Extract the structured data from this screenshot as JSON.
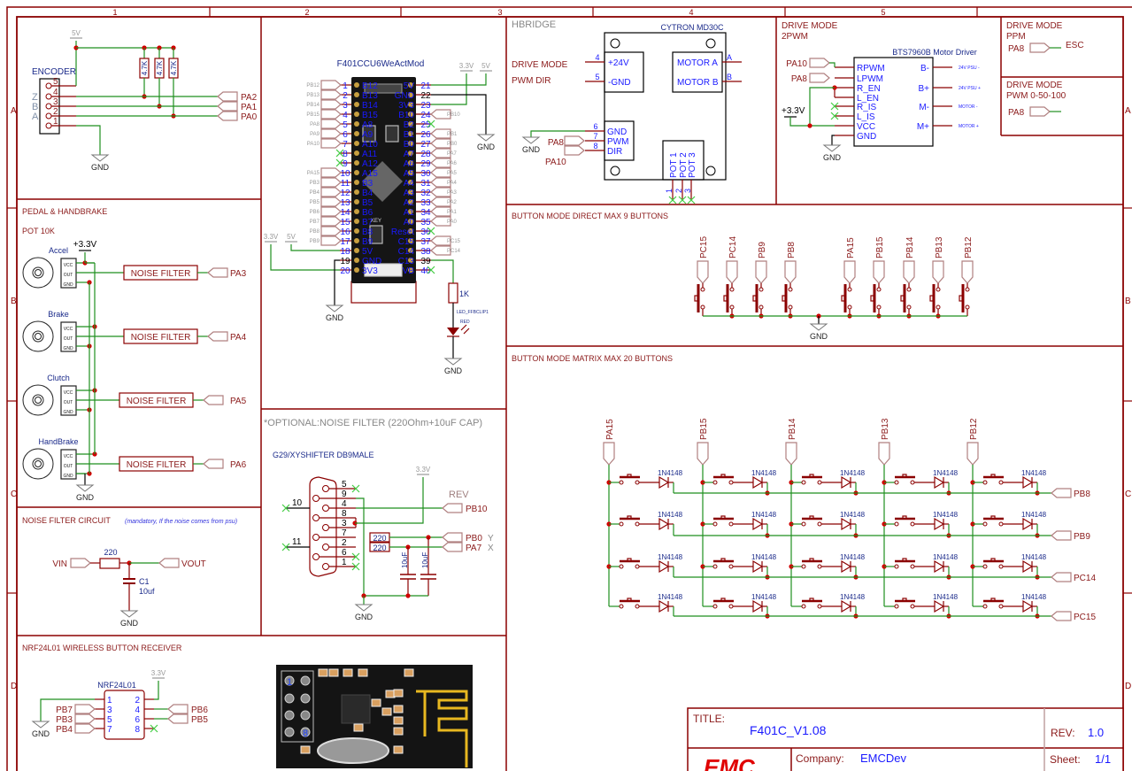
{
  "frame": {
    "columns": [
      "1",
      "2",
      "3",
      "4",
      "5"
    ],
    "rows": [
      "A",
      "B",
      "C",
      "D"
    ]
  },
  "colors": {
    "frame": "#8b0000",
    "wire": "#1f8f1f",
    "part": "#8b0000",
    "label": "#8b1a1a",
    "pin_number": "#1a1aff",
    "part_text": "#1a2a8a",
    "junction": "#d00000",
    "no_connect": "#44cc44",
    "flag": "#b08080",
    "supply": "#999999"
  },
  "encoder": {
    "title": "ENCODER",
    "supply": "5V",
    "gnd": "GND",
    "pins": [
      "5",
      "4",
      "3",
      "2",
      "1"
    ],
    "channels": [
      "Z",
      "B",
      "A"
    ],
    "resistors": [
      "4.7K",
      "4.7K",
      "4.7K"
    ],
    "nets": [
      "PA2",
      "PA1",
      "PA0"
    ]
  },
  "mcu": {
    "title": "F401CCU6WeActMod",
    "left_pins": [
      {
        "num": "1",
        "name": "B12",
        "net": "PB12"
      },
      {
        "num": "2",
        "name": "B13",
        "net": "PB13"
      },
      {
        "num": "3",
        "name": "B14",
        "net": "PB14"
      },
      {
        "num": "4",
        "name": "B15",
        "net": "PB15"
      },
      {
        "num": "5",
        "name": "A8",
        "net": "PA8"
      },
      {
        "num": "6",
        "name": "A9",
        "net": "PA9"
      },
      {
        "num": "7",
        "name": "A10",
        "net": "PA10"
      },
      {
        "num": "8",
        "name": "A11"
      },
      {
        "num": "9",
        "name": "A12"
      },
      {
        "num": "10",
        "name": "A15",
        "net": "PA15"
      },
      {
        "num": "11",
        "name": "B3",
        "net": "PB3"
      },
      {
        "num": "12",
        "name": "B4",
        "net": "PB4"
      },
      {
        "num": "13",
        "name": "B5",
        "net": "PB5"
      },
      {
        "num": "14",
        "name": "B6",
        "net": "PB6"
      },
      {
        "num": "15",
        "name": "B7",
        "net": "PB7"
      },
      {
        "num": "16",
        "name": "B8",
        "net": "PB8"
      },
      {
        "num": "17",
        "name": "B9",
        "net": "PB9"
      },
      {
        "num": "18",
        "name": "5V"
      },
      {
        "num": "19",
        "name": "GND"
      },
      {
        "num": "20",
        "name": "3V3"
      }
    ],
    "right_pins": [
      {
        "num": "21",
        "name": "5V"
      },
      {
        "num": "22",
        "name": "GND"
      },
      {
        "num": "23",
        "name": "3V3"
      },
      {
        "num": "24",
        "name": "B10",
        "net": "PB10"
      },
      {
        "num": "25",
        "name": "B2"
      },
      {
        "num": "26",
        "name": "B1",
        "net": "PB1"
      },
      {
        "num": "27",
        "name": "B0",
        "net": "PB0"
      },
      {
        "num": "28",
        "name": "A7",
        "net": "PA7"
      },
      {
        "num": "29",
        "name": "A6",
        "net": "PA6"
      },
      {
        "num": "30",
        "name": "A5",
        "net": "PA5"
      },
      {
        "num": "31",
        "name": "A4",
        "net": "PA4"
      },
      {
        "num": "32",
        "name": "A3",
        "net": "PA3"
      },
      {
        "num": "33",
        "name": "A2",
        "net": "PA2"
      },
      {
        "num": "34",
        "name": "A1",
        "net": "PA1"
      },
      {
        "num": "35",
        "name": "A0",
        "net": "PA0"
      },
      {
        "num": "36",
        "name": "Reset"
      },
      {
        "num": "37",
        "name": "C15",
        "net": "PC15"
      },
      {
        "num": "38",
        "name": "C14",
        "net": "PC14"
      },
      {
        "num": "39",
        "name": "C13"
      },
      {
        "num": "40",
        "name": "VB"
      }
    ],
    "supply_33": "3.3V",
    "supply_5": "5V",
    "gnd": "GND",
    "resistor": "1K",
    "led": "LED_FFBCLIP1",
    "led_color": "RED",
    "board_key": "KEY"
  },
  "pedals": {
    "title": "PEDAL & HANDBRAKE",
    "subtitle": "POT 10K",
    "supply": "+3.3V",
    "gnd": "GND",
    "pin_labels": [
      "VCC",
      "OUT",
      "GND"
    ],
    "items": [
      {
        "name": "Accel",
        "filter": "NOISE FILTER",
        "net": "PA3"
      },
      {
        "name": "Brake",
        "filter": "NOISE FILTER",
        "net": "PA4"
      },
      {
        "name": "Clutch",
        "filter": "NOISE FILTER",
        "net": "PA5"
      },
      {
        "name": "HandBrake",
        "filter": "NOISE FILTER",
        "net": "PA6"
      }
    ]
  },
  "noise_filter": {
    "title": "NOISE FILTER CIRCUIT",
    "note": "(mandatory, If the noise comes from psu)",
    "vin": "VIN",
    "vout": "VOUT",
    "resistor": "220",
    "cap_ref": "C1",
    "cap_value": "10uf",
    "gnd": "GND"
  },
  "optional_note": "*OPTIONAL:NOISE FILTER (220Ohm+10uF CAP)",
  "db9": {
    "title": "G29/XYSHIFTER DB9MALE",
    "pins": [
      "5",
      "9",
      "4",
      "8",
      "3",
      "7",
      "2",
      "6",
      "1"
    ],
    "shell_pins": [
      "10",
      "11"
    ],
    "supply": "3.3V",
    "rev": "REV",
    "nets": [
      {
        "net": "PB10"
      },
      {
        "net": "PB0",
        "axis": "Y"
      },
      {
        "net": "PA7",
        "axis": "X"
      }
    ],
    "resistors": [
      "220",
      "220"
    ],
    "caps": [
      "10uF",
      "10uF"
    ],
    "gnd": "GND"
  },
  "nrf": {
    "section_title": "NRF24L01 WIRELESS BUTTON RECEIVER",
    "title": "NRF24L01",
    "supply": "3.3V",
    "gnd": "GND",
    "left_pins": [
      "1",
      "3",
      "5",
      "7"
    ],
    "right_pins": [
      "2",
      "4",
      "6",
      "8"
    ],
    "left_nets": [
      "PB7",
      "PB3",
      "PB4"
    ],
    "right_nets": [
      "PB6",
      "PB5"
    ],
    "image_pin_labels": [
      "1",
      "8"
    ]
  },
  "hbridge": {
    "section": "HBRIDGE",
    "title": "CYTRON MD30C",
    "labels": [
      "DRIVE MODE",
      "PWM DIR"
    ],
    "power_pins": [
      {
        "num": "4",
        "name": "+24V"
      },
      {
        "num": "5",
        "name": "-GND"
      }
    ],
    "motor_pins": [
      {
        "name": "MOTOR A",
        "net": "A"
      },
      {
        "name": "MOTOR B",
        "net": "B"
      }
    ],
    "ctrl_pins": [
      {
        "num": "6",
        "name": "GND"
      },
      {
        "num": "7",
        "name": "PWM"
      },
      {
        "num": "8",
        "name": "DIR"
      }
    ],
    "pot_pins": [
      {
        "num": "1",
        "name": "POT 1"
      },
      {
        "num": "2",
        "name": "POT 2"
      },
      {
        "num": "3",
        "name": "POT 3"
      }
    ],
    "gnd": "GND",
    "nets": [
      "PA8",
      "PA10"
    ]
  },
  "drive_2pwm": {
    "title": [
      "DRIVE MODE",
      "2PWM"
    ],
    "chip": "BTS7960B Motor Driver",
    "left_pins": [
      "RPWM",
      "LPWM",
      "R_EN",
      "L_EN",
      "R_IS",
      "L_IS",
      "VCC",
      "GND"
    ],
    "right_pins": [
      {
        "name": "B-",
        "net": "24V PSU -"
      },
      {
        "name": "B+",
        "net": "24V PSU +"
      },
      {
        "name": "M-",
        "net": "MOTOR -"
      },
      {
        "name": "M+",
        "net": "MOTOR +"
      }
    ],
    "nets": [
      "PA10",
      "PA8"
    ],
    "supply": "+3.3V",
    "gnd": "GND"
  },
  "drive_ppm": {
    "title": [
      "DRIVE MODE",
      "PPM"
    ],
    "net": "PA8",
    "output": "ESC"
  },
  "drive_pwm": {
    "title": [
      "DRIVE MODE",
      "PWM 0-50-100"
    ],
    "net": "PA8"
  },
  "direct_buttons": {
    "title": "BUTTON MODE DIRECT MAX 9 BUTTONS",
    "nets": [
      "PC15",
      "PC14",
      "PB9",
      "PB8",
      "PA15",
      "PB15",
      "PB14",
      "PB13",
      "PB12"
    ],
    "gnd": "GND"
  },
  "matrix": {
    "title": "BUTTON MODE MATRIX MAX 20 BUTTONS",
    "columns": [
      "PA15",
      "PB15",
      "PB14",
      "PB13",
      "PB12"
    ],
    "rows": [
      "PB8",
      "PB9",
      "PC14",
      "PC15"
    ],
    "diode": "1N4148"
  },
  "title_block": {
    "title_label": "TITLE:",
    "title": "F401C_V1.08",
    "rev_label": "REV:",
    "rev": "1.0",
    "company_label": "Company:",
    "company": "EMCDev",
    "sheet_label": "Sheet:",
    "sheet": "1/1",
    "logo": "EMC"
  }
}
